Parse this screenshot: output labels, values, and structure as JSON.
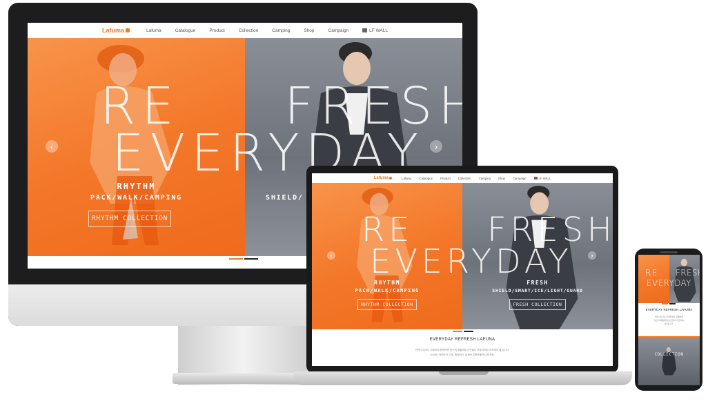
{
  "brand": {
    "accent": "#f07a1f",
    "accent_dark": "#e36a17",
    "logo": "Lafuma"
  },
  "nav": {
    "items": [
      "Lafuma",
      "Catalogue",
      "Product",
      "Collection",
      "Camping",
      "Shop",
      "Campaign"
    ],
    "wall": "LF WALL"
  },
  "hero": {
    "headline_left": "RE",
    "headline_right": "FRESH",
    "headline_row2": "EVERYDAY",
    "left": {
      "title": "RHYTHM",
      "subtitle": "PACK/WALK/CAMPING",
      "button": "RHYTHM COLLECTION"
    },
    "right": {
      "title": "FRESH",
      "subtitle": "SHIELD/SMART/ICE/LIGHT/GUARD",
      "button": "FRESH COLLECTION"
    },
    "monitor_right_subtitle": "SHIELD/",
    "arrow_prev": "‹",
    "arrow_next": "›"
  },
  "section": {
    "title": "EVERYDAY REFRESH LAFUNA",
    "phone_title": "EVERYDAY REFRESH LAFUMA",
    "body_line1": "언제 어디서나 라푸마와 함께하면 당신의 매일매일 순간들이 라푸마처럼 리프레쉬 될 겁니다.",
    "body_line2": "2016년 라푸마의 '다짐, 함께하기' 뮤째라 콘텐츠를 만나보세요.",
    "phone_body1": "언제 어디서나 라푸마와 함께하면",
    "phone_body2": "당신의 매일매일 순간들이 리프레쉬",
    "phone_body3": "될 겁니다.",
    "phone_banner": "COLLECTION"
  }
}
